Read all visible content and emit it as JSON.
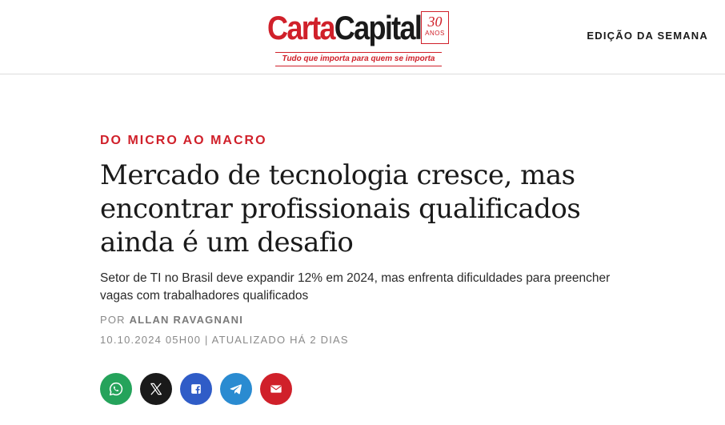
{
  "header": {
    "logo": {
      "carta": "Carta",
      "capital": "Capital",
      "badge_number": "30",
      "badge_label": "ANOS",
      "tagline": "Tudo que importa para quem se importa"
    },
    "edition_link": "EDIÇÃO DA SEMANA"
  },
  "article": {
    "kicker": "DO MICRO AO MACRO",
    "headline": "Mercado de tecnologia cresce, mas encontrar profissionais qualificados ainda é um desafio",
    "subtitle": "Setor de TI no Brasil deve expandir 12% em 2024, mas enfrenta dificuldades para preencher vagas com trabalhadores qualificados",
    "byline_prefix": "POR",
    "author": "ALLAN RAVAGNANI",
    "dateline": "10.10.2024 05H00 | ATUALIZADO HÁ 2 DIAS"
  },
  "share": {
    "buttons": [
      {
        "icon": "whatsapp-icon",
        "color": "#25a35b"
      },
      {
        "icon": "x-icon",
        "color": "#1a1a1a"
      },
      {
        "icon": "facebook-icon",
        "color": "#2f5cc7"
      },
      {
        "icon": "telegram-icon",
        "color": "#2a8bd1"
      },
      {
        "icon": "email-icon",
        "color": "#d0202a"
      }
    ]
  },
  "colors": {
    "brand_red": "#d0202a",
    "text_dark": "#1a1a1a",
    "meta_gray": "#8a8a8a",
    "divider": "#dcdcdc"
  }
}
